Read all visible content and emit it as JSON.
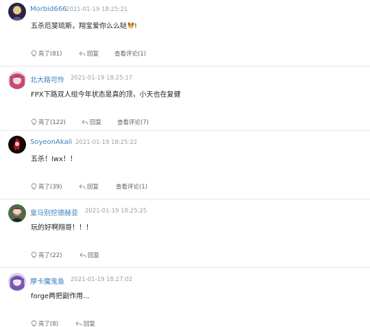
{
  "comments": [
    {
      "username": "Morbid666",
      "time": "2021-01-19 18:25:21",
      "text": "五杀厄斐琉斯，翔宝爱你么么哒",
      "text_suffix": "!",
      "emoji_icon": "dog-face-emoji-icon",
      "like_label": "亮了(81)",
      "reply_label": "回复",
      "view_replies_label": "查看评论(1)"
    },
    {
      "username": "北大路可怜",
      "time": "2021-01-19 18:25:17",
      "text": "FPX下路双人组今年状态是真的顶，小天也在复健",
      "like_label": "亮了(122)",
      "reply_label": "回复",
      "view_replies_label": "查看评论(7)"
    },
    {
      "username": "SoyeonAkali",
      "time": "2021-01-19 18:25:22",
      "text": "五杀！lwx！！",
      "like_label": "亮了(39)",
      "reply_label": "回复",
      "view_replies_label": "查看评论(1)"
    },
    {
      "username": "皇马别挖德赫亚",
      "time": "2021-01-19 18:25:25",
      "text": "玩的好啊翔哥！！！",
      "like_label": "亮了(22)",
      "reply_label": "回复"
    },
    {
      "username": "摩卡魔鬼鱼",
      "time": "2021-01-19 18:27:02",
      "text": "forge两把副作用...",
      "like_label": "亮了(8)",
      "reply_label": "回复"
    }
  ],
  "icons": {
    "like": "lightbulb-icon",
    "reply": "reply-arrow-icon"
  },
  "colors": {
    "username": "#3d7fbf",
    "timestamp": "#9aa0a8",
    "action_text": "#5b6069",
    "divider": "#e6e7ea"
  }
}
